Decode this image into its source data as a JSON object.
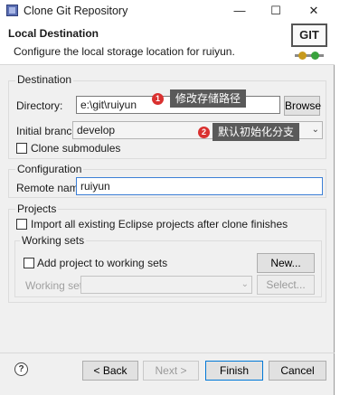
{
  "window": {
    "title": "Clone Git Repository",
    "minimize_glyph": "—",
    "maximize_glyph": "☐",
    "close_glyph": "✕",
    "app_icon": "eclipse-app-icon"
  },
  "header": {
    "title": "Local Destination",
    "description": "Configure the local storage location for ruiyun.",
    "logo_text": "GIT"
  },
  "destination": {
    "legend": "Destination",
    "directory_label": "Directory:",
    "directory_value": "e:\\git\\ruiyun",
    "browse_label": "Browse",
    "branch_label": "Initial branch:",
    "branch_value": "develop",
    "clone_submodules_label": "Clone submodules"
  },
  "configuration": {
    "legend": "Configuration",
    "remote_label": "Remote name:",
    "remote_value": "ruiyun"
  },
  "projects": {
    "legend": "Projects",
    "import_label": "Import all existing Eclipse projects after clone finishes",
    "working_sets": {
      "legend": "Working sets",
      "add_label": "Add project to working sets",
      "new_label": "New...",
      "sets_label": "Working sets:",
      "select_label": "Select..."
    }
  },
  "annotations": [
    {
      "number": "1",
      "text": "修改存储路径"
    },
    {
      "number": "2",
      "text": "默认初始化分支"
    }
  ],
  "footer": {
    "help_glyph": "?",
    "back_label": "< Back",
    "next_label": "Next >",
    "finish_label": "Finish",
    "cancel_label": "Cancel"
  }
}
